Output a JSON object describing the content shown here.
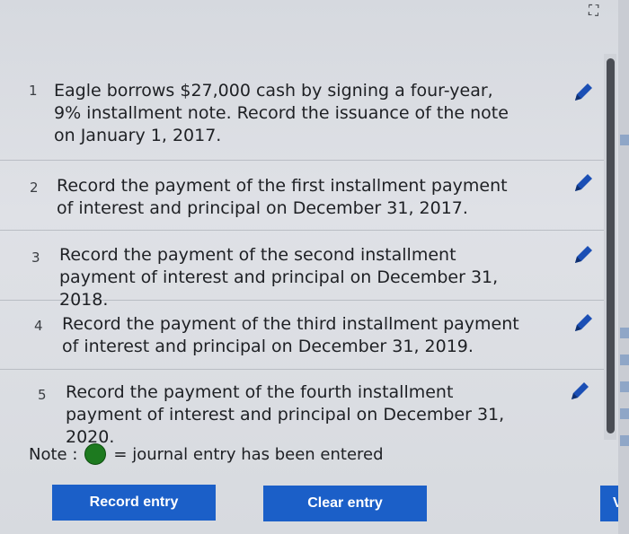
{
  "tasks": [
    {
      "number": "1",
      "text": "Eagle borrows $27,000 cash by signing a four-year, 9% installment note. Record the issuance of the note on January 1, 2017."
    },
    {
      "number": "2",
      "text": "Record the payment of the first installment payment of interest and principal on December 31, 2017."
    },
    {
      "number": "3",
      "text": "Record the payment of the second installment payment of interest and principal on December 31, 2018."
    },
    {
      "number": "4",
      "text": "Record the payment of the third installment payment of interest and principal on December 31, 2019."
    },
    {
      "number": "5",
      "text": "Record the payment of the fourth installment payment of interest and principal on December 31, 2020."
    }
  ],
  "note": {
    "prefix": "Note :",
    "suffix": "= journal entry has been entered",
    "indicator_color": "#1d7a1f"
  },
  "buttons": {
    "record_entry": "Record entry",
    "clear_entry": "Clear entry",
    "view_partial": "Vi"
  },
  "colors": {
    "button_blue": "#1b5fc8",
    "edit_icon_blue": "#1b4fb5"
  },
  "icons": {
    "edit": "pencil-icon",
    "corner": "expand-icon"
  }
}
